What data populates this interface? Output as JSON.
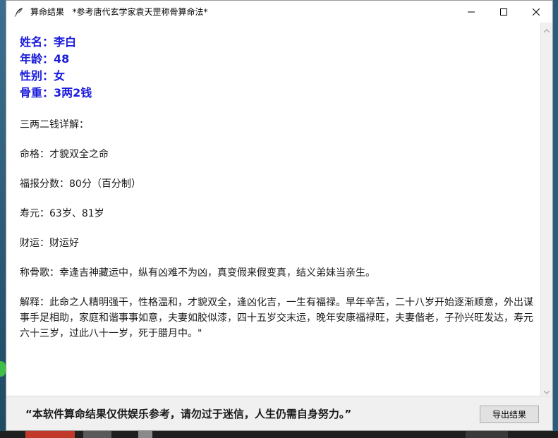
{
  "window": {
    "title": "算命结果   *参考唐代玄学家袁天罡称骨算命法*"
  },
  "info": {
    "name": "姓名：李白",
    "age": "年龄：48",
    "gender": "性别：女",
    "weight": "骨重：3两2钱"
  },
  "detail": {
    "heading": "三两二钱详解：",
    "fate": "命格：才貌双全之命",
    "fortune_score": "福报分数：80分（百分制）",
    "lifespan": "寿元：63岁、81岁",
    "wealth": "财运：财运好",
    "song": "称骨歌：幸逢吉神藏运中，纵有凶难不为凶，真变假来假变真，结义弟妹当亲生。",
    "explanation": "解释：此命之人精明强干，性格温和，才貌双全，逢凶化吉，一生有福禄。早年辛苦，二十八岁开始逐渐顺意，外出谋事手足相助，家庭和谐事事如意，夫妻如胶似漆，四十五岁交末运，晚年安康福禄旺，夫妻偕老，子孙兴旺发达，寿元六十三岁，过此八十一岁，死于腊月中。\""
  },
  "footer": {
    "disclaimer": "“本软件算命结果仅供娱乐参考，请勿过于迷信，人生仍需自身努力。”",
    "export_label": "导出结果"
  },
  "icons": {
    "app": "feather-icon",
    "minimize": "minimize-icon",
    "maximize": "maximize-icon",
    "close": "close-icon"
  },
  "colors": {
    "info_text": "#1a1adc",
    "footer_bg": "#f0f0f0"
  }
}
